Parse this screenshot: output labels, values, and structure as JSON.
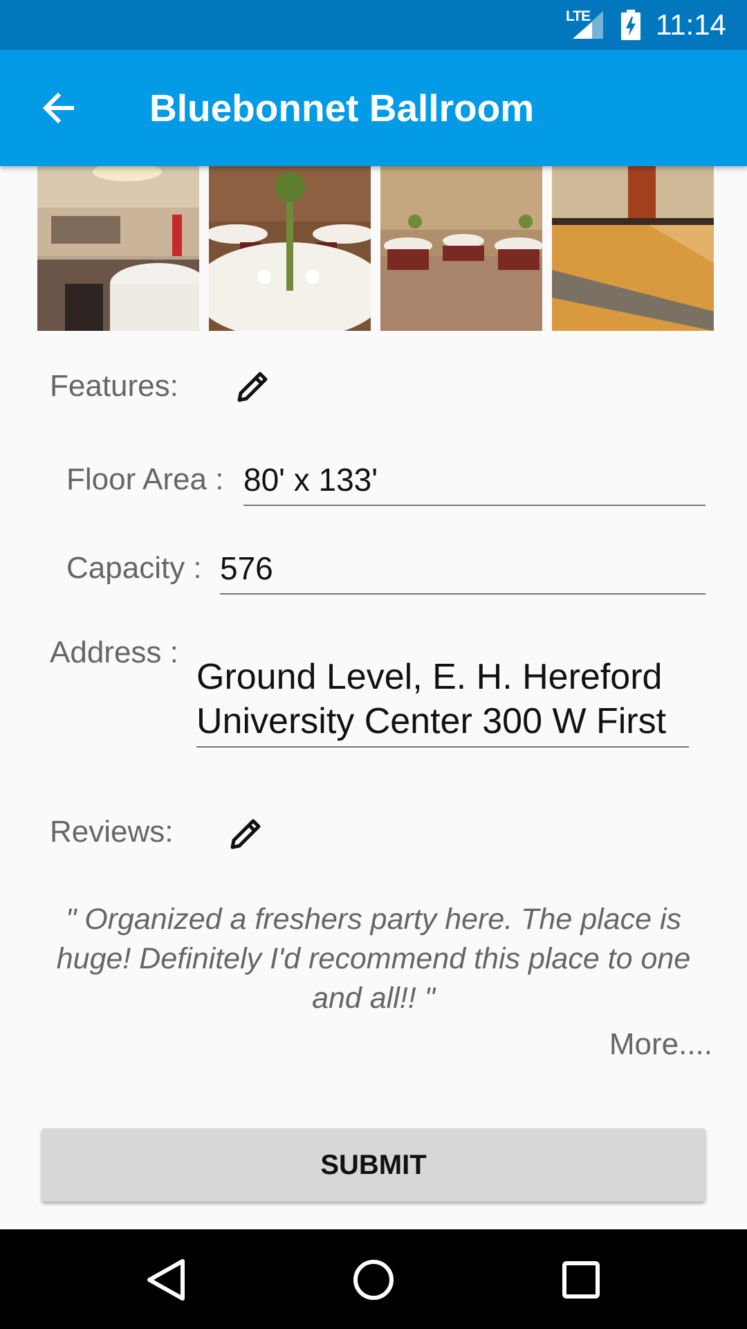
{
  "status_bar": {
    "network": "LTE",
    "time": "11:14",
    "icons": [
      "signal-icon",
      "battery-charging-icon"
    ]
  },
  "app_bar": {
    "title": "Bluebonnet Ballroom",
    "back_icon": "arrow-back-icon"
  },
  "gallery": {
    "photos": [
      "ballroom-photo-1",
      "ballroom-photo-2",
      "ballroom-photo-3",
      "ballroom-photo-4"
    ]
  },
  "features": {
    "label": "Features:",
    "floor_area_label": "Floor Area :",
    "floor_area_value": "80' x 133'",
    "capacity_label": "Capacity :",
    "capacity_value": "576",
    "address_label": "Address :",
    "address_line1": "Ground Level, E. H. Hereford",
    "address_line2": "University Center 300 W First"
  },
  "reviews": {
    "label": "Reviews:",
    "text": "\" Organized a freshers party here. The place is huge! Definitely I'd recommend this place to one and all!!  \"",
    "more_label": "More...."
  },
  "submit_label": "SUBMIT",
  "nav_bar": {
    "icons": [
      "nav-back-icon",
      "nav-home-icon",
      "nav-recents-icon"
    ]
  },
  "colors": {
    "status_bar": "#0277bd",
    "app_bar": "#039be5",
    "background": "#fafafa",
    "button": "#d6d7d7"
  }
}
